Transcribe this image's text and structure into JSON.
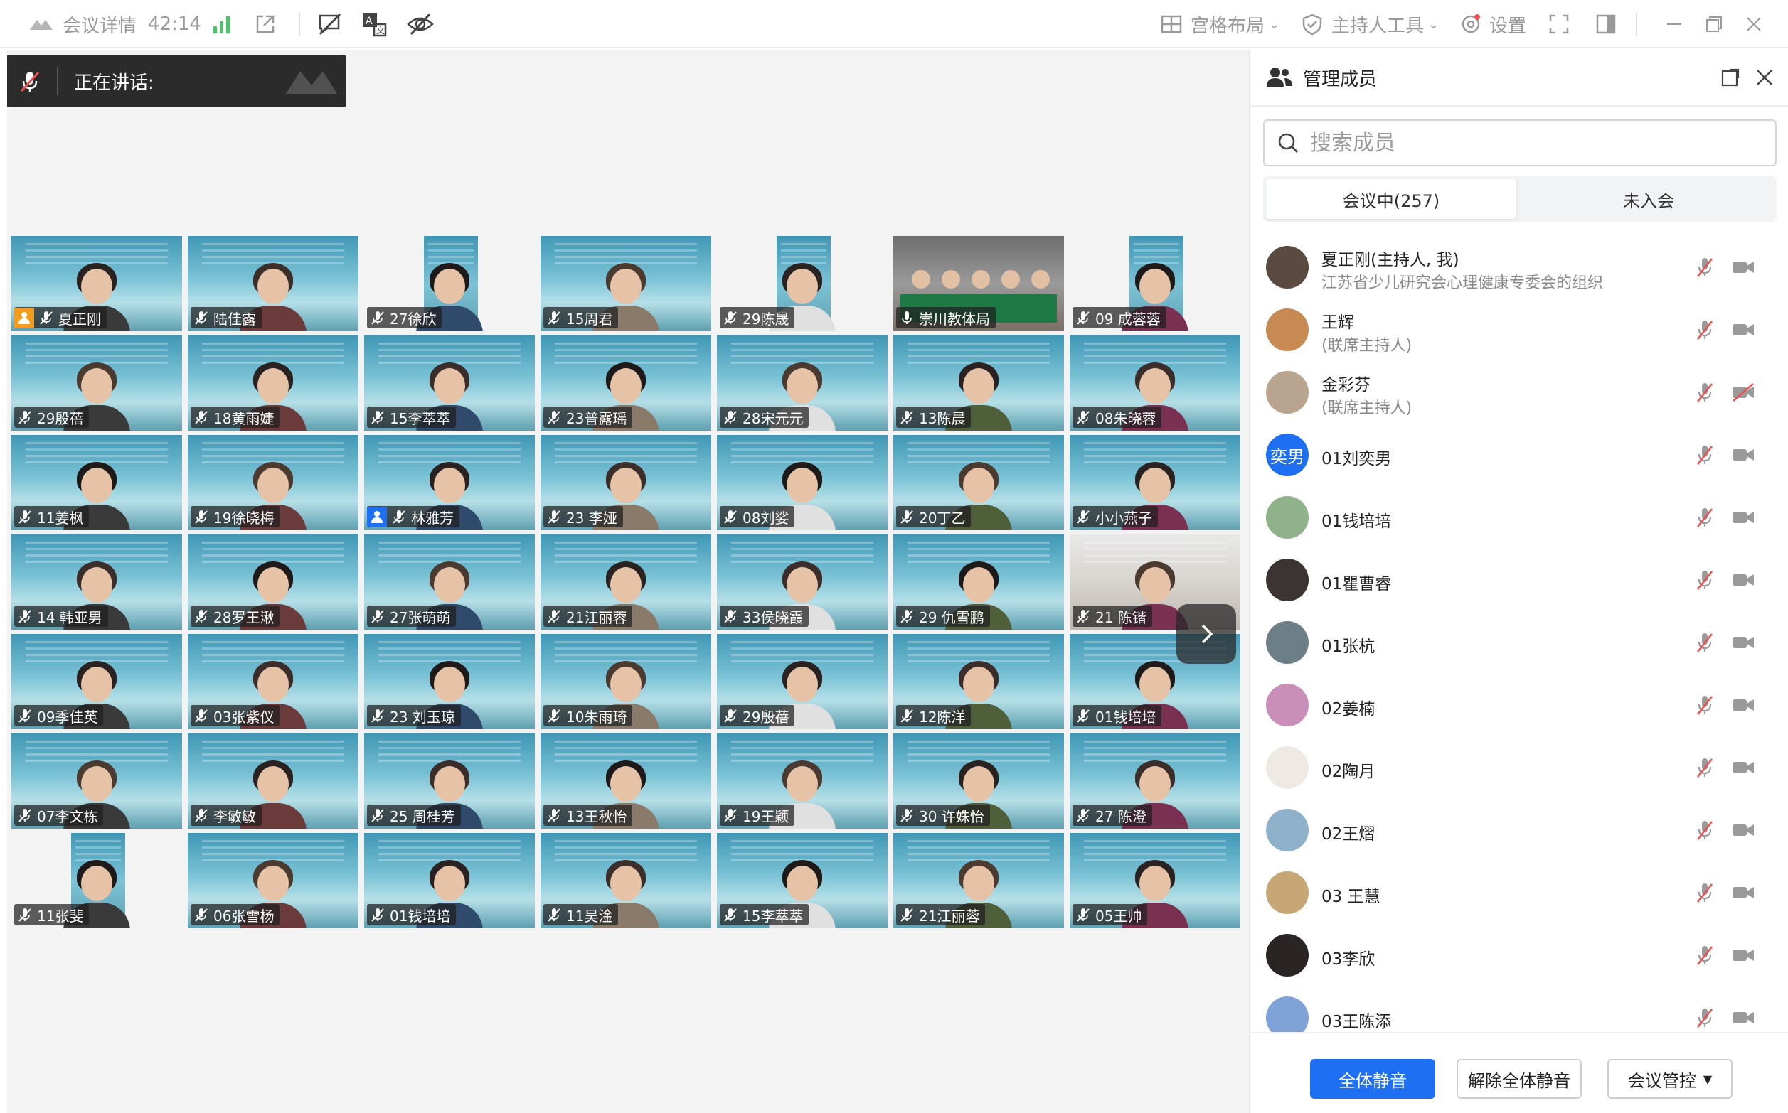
{
  "topbar": {
    "meeting_details_label": "会议详情",
    "timer": "42:14",
    "layout_label": "宫格布局",
    "host_tools_label": "主持人工具",
    "settings_label": "设置"
  },
  "speaking": {
    "label": "正在讲话:"
  },
  "tiles": [
    {
      "name": "夏正刚",
      "role": "host"
    },
    {
      "name": "陆佳露"
    },
    {
      "name": "27徐欣",
      "narrow": true
    },
    {
      "name": "15周君"
    },
    {
      "name": "29陈晟",
      "narrow": true
    },
    {
      "name": "崇川教体局",
      "room": true,
      "unmuted": true
    },
    {
      "name": "09 成蓉蓉",
      "narrow": true
    },
    {
      "name": "29殷蓓"
    },
    {
      "name": "18黄雨婕"
    },
    {
      "name": "15李萃萃"
    },
    {
      "name": "23普露瑶"
    },
    {
      "name": "28宋元元"
    },
    {
      "name": "13陈晨"
    },
    {
      "name": "08朱晓蓉"
    },
    {
      "name": "11姜枫"
    },
    {
      "name": "19徐晓梅"
    },
    {
      "name": "林雅芳",
      "role": "cohost"
    },
    {
      "name": "23 李娅"
    },
    {
      "name": "08刘娑"
    },
    {
      "name": "20丁乙"
    },
    {
      "name": "小小燕子"
    },
    {
      "name": "14 韩亚男"
    },
    {
      "name": "28罗王湫"
    },
    {
      "name": "27张萌萌"
    },
    {
      "name": "21江丽蓉"
    },
    {
      "name": "33侯晓霞"
    },
    {
      "name": "29 仇雪鹏"
    },
    {
      "name": "21 陈锴",
      "light": true
    },
    {
      "name": "09季佳英"
    },
    {
      "name": "03张紫仪"
    },
    {
      "name": "23  刘玉琼"
    },
    {
      "name": "10朱雨琦"
    },
    {
      "name": "29殷蓓"
    },
    {
      "name": "12陈洋"
    },
    {
      "name": "01钱培培"
    },
    {
      "name": "07李文栋"
    },
    {
      "name": "李敏敏"
    },
    {
      "name": "25 周桂芳"
    },
    {
      "name": "13王秋怡"
    },
    {
      "name": "19王颖"
    },
    {
      "name": "30 许姝怡"
    },
    {
      "name": "27 陈澄"
    },
    {
      "name": "11张斐",
      "narrow": true
    },
    {
      "name": "06张雪杨"
    },
    {
      "name": "01钱培培"
    },
    {
      "name": "11吴淦"
    },
    {
      "name": "15李萃萃"
    },
    {
      "name": "21江丽蓉"
    },
    {
      "name": "05王帅"
    }
  ],
  "panel": {
    "title": "管理成员",
    "search_placeholder": "搜索成员",
    "tab_in_meeting": "会议中(257)",
    "tab_not_joined": "未入会",
    "members": [
      {
        "name": "夏正刚(主持人, 我)",
        "sub": "江苏省少儿研究会心理健康专委会的组织",
        "avatar_color": "#5a4a40"
      },
      {
        "name": "王辉",
        "sub": "(联席主持人)",
        "avatar_color": "#c78a52"
      },
      {
        "name": "金彩芬",
        "sub": "(联席主持人)",
        "avatar_color": "#b9a48f",
        "cam_off": true
      },
      {
        "name": "01刘奕男",
        "avatar_text": "奕男",
        "avatar_color": "#1f6ff2"
      },
      {
        "name": "01钱培培",
        "avatar_color": "#8fb28b"
      },
      {
        "name": "01瞿曹睿",
        "avatar_color": "#3b3433"
      },
      {
        "name": "01张杭",
        "avatar_color": "#6c7f86"
      },
      {
        "name": "02姜楠",
        "avatar_color": "#c98fb8"
      },
      {
        "name": "02陶月",
        "avatar_color": "#efe9e4"
      },
      {
        "name": "02王熠",
        "avatar_color": "#8fb1c9"
      },
      {
        "name": "03 王慧",
        "avatar_color": "#c7a676"
      },
      {
        "name": "03李欣",
        "avatar_color": "#2a2424"
      },
      {
        "name": "03王陈添",
        "avatar_color": "#7fa3d6"
      }
    ],
    "mute_all_label": "全体静音",
    "unmute_all_label": "解除全体静音",
    "meeting_control_label": "会议管控"
  }
}
